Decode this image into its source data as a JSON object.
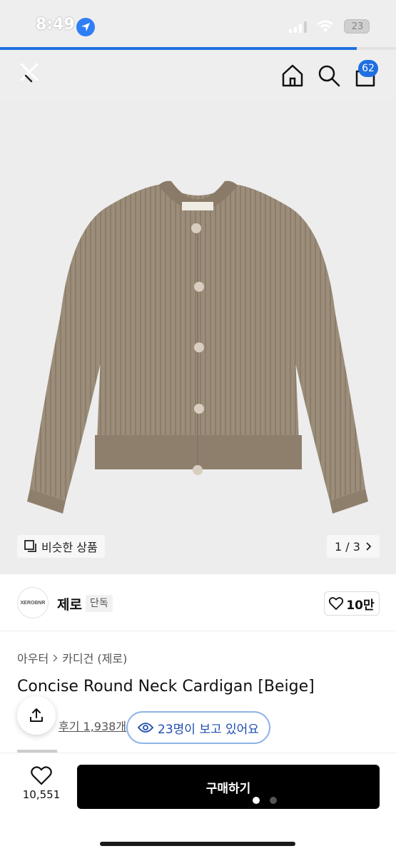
{
  "status_bar": {
    "time": "8:49",
    "battery": "23",
    "page_load_progress": 0.9
  },
  "header": {
    "close_icon": "close-icon",
    "home_icon": "home-icon",
    "search_icon": "search-icon",
    "cart_icon": "cart-icon",
    "cart_count": "62"
  },
  "gallery": {
    "similar_label": "비슷한 상품",
    "counter": "1 / 3"
  },
  "brand": {
    "logo_text": "XEROBNR",
    "name": "제로",
    "badge": "단독",
    "likes": "10만"
  },
  "product": {
    "breadcrumb": [
      "아우터",
      "카디건 (제로)"
    ],
    "title": "Concise Round Neck Cardigan [Beige]",
    "reviews": "후기 1,938개",
    "viewers": "23명이 보고 있어요"
  },
  "bottom_bar": {
    "wish_count": "10,551",
    "buy_label": "구매하기"
  },
  "colors": {
    "accent": "#1f6fe0",
    "cardigan": "#9a8b78",
    "buy_button": "#000000"
  }
}
